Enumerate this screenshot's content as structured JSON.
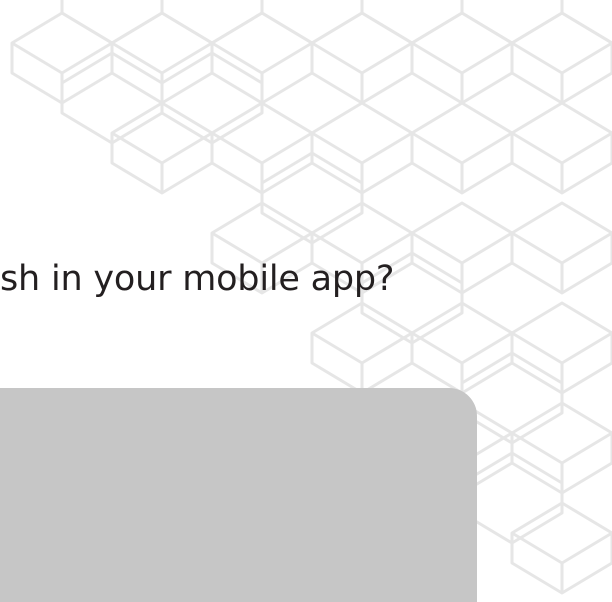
{
  "question": {
    "text": "sh in your mobile app?"
  },
  "answer_panel": {
    "color": "#c6c6c6"
  },
  "background_pattern": {
    "icon": "isometric-cube-lattice",
    "color": "#e6e6e6"
  }
}
